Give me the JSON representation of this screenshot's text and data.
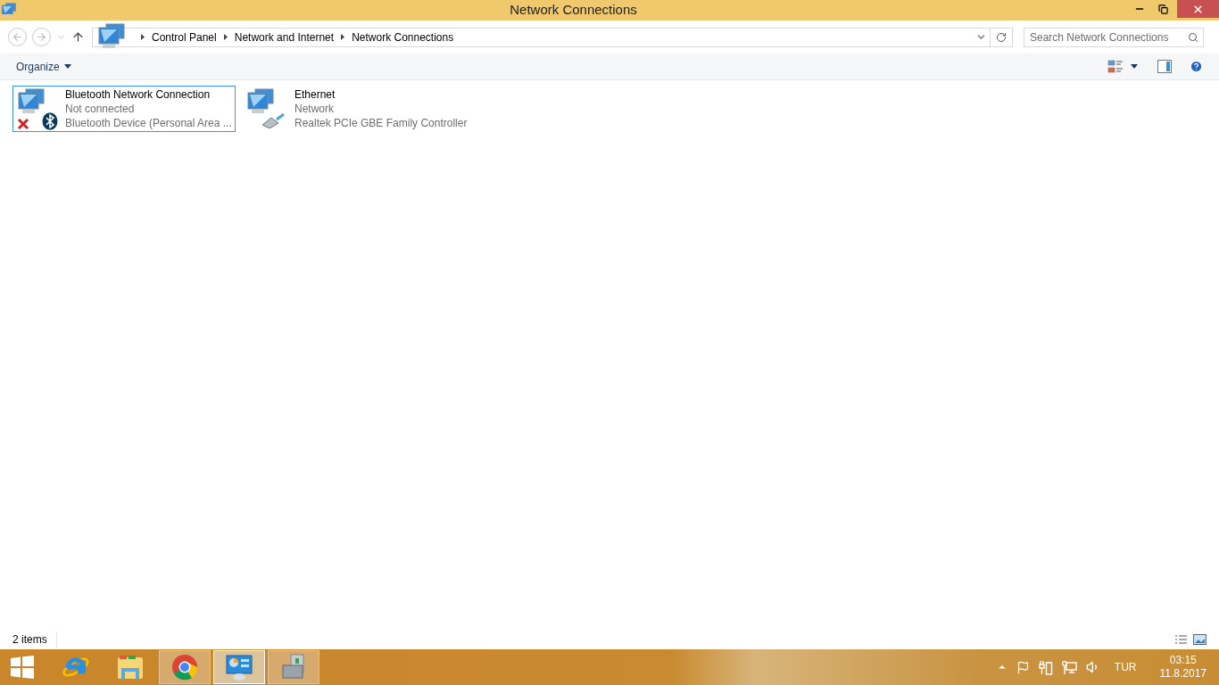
{
  "window": {
    "title": "Network Connections"
  },
  "address_bar": {
    "breadcrumbs": [
      "Control Panel",
      "Network and Internet",
      "Network Connections"
    ]
  },
  "search": {
    "placeholder": "Search Network Connections"
  },
  "toolbar": {
    "organize": "Organize"
  },
  "connections": [
    {
      "name": "Bluetooth Network Connection",
      "status": "Not connected",
      "device": "Bluetooth Device (Personal Area ...",
      "kind": "bluetooth",
      "connected": false,
      "selected": true
    },
    {
      "name": "Ethernet",
      "status": "Network",
      "device": "Realtek PCIe GBE Family Controller",
      "kind": "ethernet",
      "connected": true,
      "selected": false
    }
  ],
  "status_bar": {
    "item_count": "2 items"
  },
  "taskbar": {
    "apps": [
      {
        "kind": "ie",
        "running": false,
        "selected": false
      },
      {
        "kind": "explorer",
        "running": false,
        "selected": false
      },
      {
        "kind": "chrome",
        "running": true,
        "selected": false
      },
      {
        "kind": "control-panel",
        "running": true,
        "selected": true
      },
      {
        "kind": "toolbox",
        "running": true,
        "selected": false
      }
    ],
    "tray": {
      "language": "TUR",
      "time": "03:15",
      "date": "11.8.2017"
    }
  }
}
